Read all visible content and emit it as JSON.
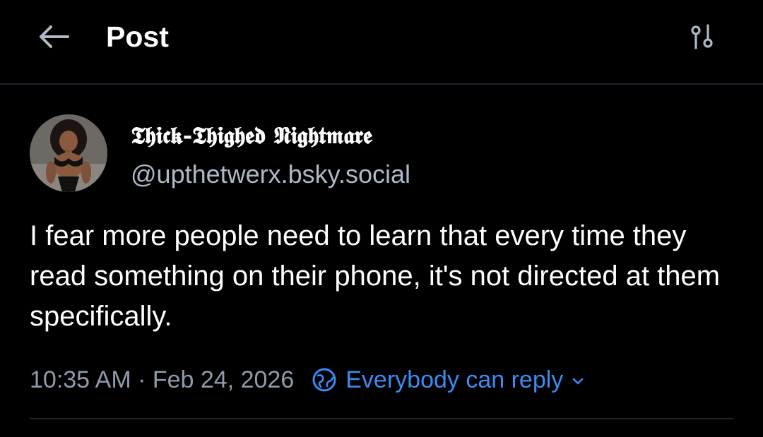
{
  "header": {
    "title": "Post",
    "back_icon": "arrow-left-icon",
    "settings_icon": "sliders-icon"
  },
  "post": {
    "author": {
      "display_name": "𝕿𝖍𝖎𝖈𝖐-𝕿𝖍𝖎𝖌𝖍𝖊𝖉 𝕹𝖎𝖌𝖍𝖙𝖒𝖆𝖗𝖊",
      "handle": "@upthetwerx.bsky.social"
    },
    "text": "I fear more people need to learn that every time they read something on their phone, it's not directed at them specifically.",
    "timestamp": "10:35 AM · Feb 24, 2026",
    "reply_settings": {
      "label": "Everybody can reply",
      "icon": "globe-icon"
    }
  },
  "colors": {
    "background": "#000000",
    "text": "#ffffff",
    "muted": "#8f9bab",
    "handle": "#aeb8c6",
    "accent": "#3b8bf2",
    "divider": "#1e2530"
  }
}
